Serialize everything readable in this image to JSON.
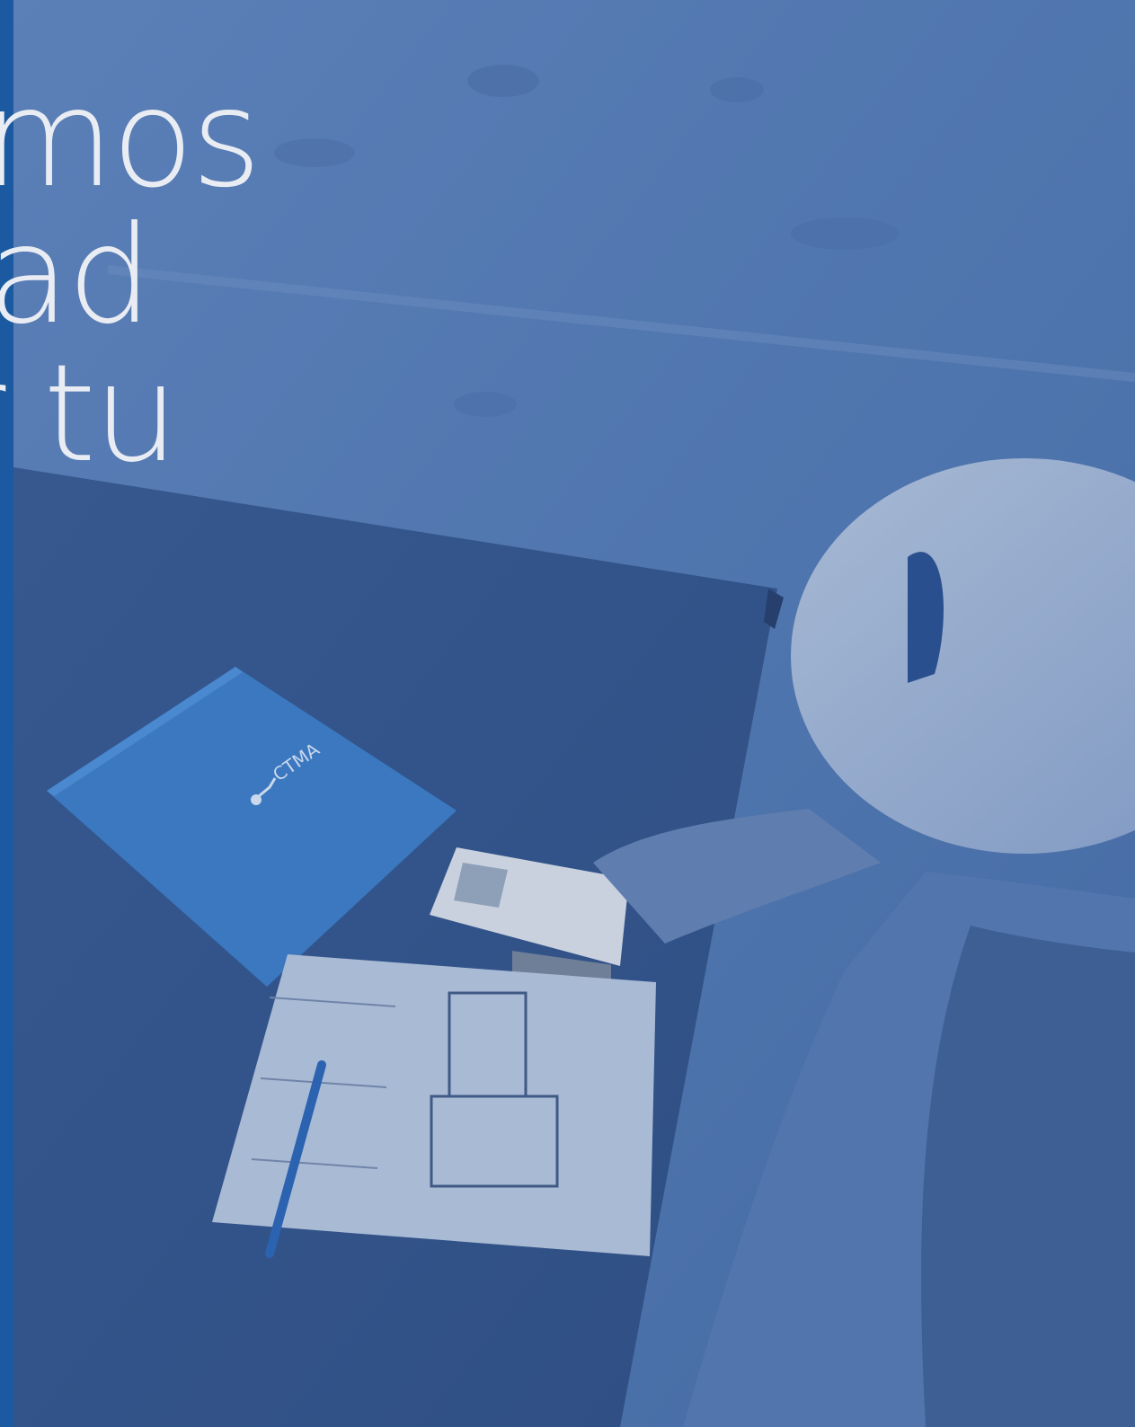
{
  "headline": {
    "lines": [
      "amos",
      "lad",
      "r tu"
    ]
  },
  "folder_logo": "CTMA",
  "colors": {
    "overlay_blue": "#3f6ba6",
    "left_bar": "#1b5aa0",
    "headline_text": "#e9edf3"
  }
}
